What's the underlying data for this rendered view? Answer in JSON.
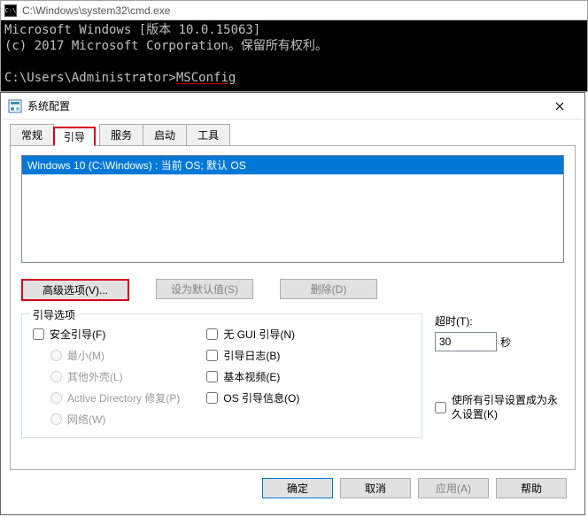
{
  "cmd": {
    "title": "C:\\Windows\\system32\\cmd.exe",
    "line1": "Microsoft Windows [版本 10.0.15063]",
    "line2": "(c) 2017 Microsoft Corporation。保留所有权利。",
    "prompt": "C:\\Users\\Administrator>",
    "command": "MSConfig"
  },
  "dialog": {
    "title": "系统配置",
    "tabs": {
      "general": "常规",
      "boot": "引导",
      "services": "服务",
      "startup": "启动",
      "tools": "工具"
    },
    "boot": {
      "entry": "Windows 10 (C:\\Windows) : 当前 OS; 默认 OS",
      "advanced": "高级选项(V)...",
      "set_default": "设为默认值(S)",
      "delete": "删除(D)",
      "options_legend": "引导选项",
      "safe_boot": "安全引导(F)",
      "minimal": "最小(M)",
      "alt_shell": "其他外壳(L)",
      "ad_repair": "Active Directory 修复(P)",
      "network": "网络(W)",
      "no_gui": "无 GUI 引导(N)",
      "boot_log": "引导日志(B)",
      "base_video": "基本视频(E)",
      "os_boot_info": "OS 引导信息(O)",
      "timeout_label": "超时(T):",
      "timeout_value": "30",
      "timeout_unit": "秒",
      "permanent": "使所有引导设置成为永久设置(K)"
    },
    "footer": {
      "ok": "确定",
      "cancel": "取消",
      "apply": "应用(A)",
      "help": "帮助"
    }
  }
}
